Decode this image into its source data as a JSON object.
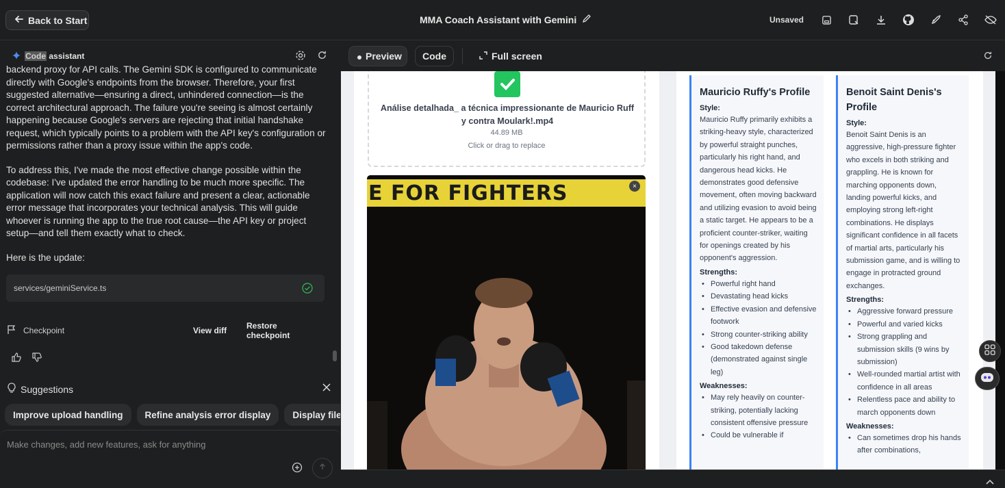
{
  "topbar": {
    "back_label": "Back to Start",
    "app_title": "MMA Coach Assistant with Gemini",
    "status": "Unsaved"
  },
  "left_panel": {
    "header_highlight": "Code",
    "header_rest": "assistant",
    "messages": [
      "backend proxy for API calls. The Gemini SDK is configured to communicate directly with Google's endpoints from the browser. Therefore, your first suggested alternative—ensuring a direct, unhindered connection—is the correct architectural approach. The failure you're seeing is almost certainly happening because Google's servers are rejecting that initial handshake request, which typically points to a problem with the API key's configuration or permissions rather than a proxy issue within the app's code.",
      "To address this, I've made the most effective change possible within the codebase: I've updated the error handling to be much more specific. The application will now catch this exact failure and present a clear, actionable error message that incorporates your technical analysis. This will guide whoever is running the app to the true root cause—the API key or project setup—and tell them exactly what to check.",
      "Here is the update:"
    ],
    "file_chip": "services/geminiService.ts",
    "checkpoint_label": "Checkpoint",
    "view_diff_label": "View diff",
    "restore_label": "Restore checkpoint",
    "suggestions_label": "Suggestions",
    "suggestion_chips": [
      "Improve upload handling",
      "Refine analysis error display",
      "Display file si"
    ],
    "composer_placeholder": "Make changes, add new features, ask for anything"
  },
  "right_panel": {
    "tabs": {
      "preview": "Preview",
      "code": "Code",
      "fullscreen": "Full screen"
    },
    "upload": {
      "file_name": "Análise detalhada_ a técnica impressionante de Mauricio Ruff y contra Moulark!.mp4",
      "file_size": "44.89 MB",
      "hint": "Click or drag to replace"
    },
    "video_banner": "E FOR FIGHTERS",
    "profiles": [
      {
        "title": "Mauricio Ruffy's Profile",
        "style_label": "Style:",
        "style": "Mauricio Ruffy primarily exhibits a striking-heavy style, characterized by powerful straight punches, particularly his right hand, and dangerous head kicks. He demonstrates good defensive movement, often moving backward and utilizing evasion to avoid being a static target. He appears to be a proficient counter-striker, waiting for openings created by his opponent's aggression.",
        "strengths_label": "Strengths:",
        "strengths": [
          "Powerful right hand",
          "Devastating head kicks",
          "Effective evasion and defensive footwork",
          "Strong counter-striking ability",
          "Good takedown defense (demonstrated against single leg)"
        ],
        "weaknesses_label": "Weaknesses:",
        "weaknesses": [
          "May rely heavily on counter-striking, potentially lacking consistent offensive pressure",
          "Could be vulnerable if"
        ]
      },
      {
        "title": "Benoit Saint Denis's Profile",
        "style_label": "Style:",
        "style": "Benoit Saint Denis is an aggressive, high-pressure fighter who excels in both striking and grappling. He is known for marching opponents down, landing powerful kicks, and employing strong left-right combinations. He displays significant confidence in all facets of martial arts, particularly his submission game, and is willing to engage in protracted ground exchanges.",
        "strengths_label": "Strengths:",
        "strengths": [
          "Aggressive forward pressure",
          "Powerful and varied kicks",
          "Strong grappling and submission skills (9 wins by submission)",
          "Well-rounded martial artist with confidence in all areas",
          "Relentless pace and ability to march opponents down"
        ],
        "weaknesses_label": "Weaknesses:",
        "weaknesses": [
          "Can sometimes drop his hands after combinations,"
        ]
      }
    ]
  }
}
